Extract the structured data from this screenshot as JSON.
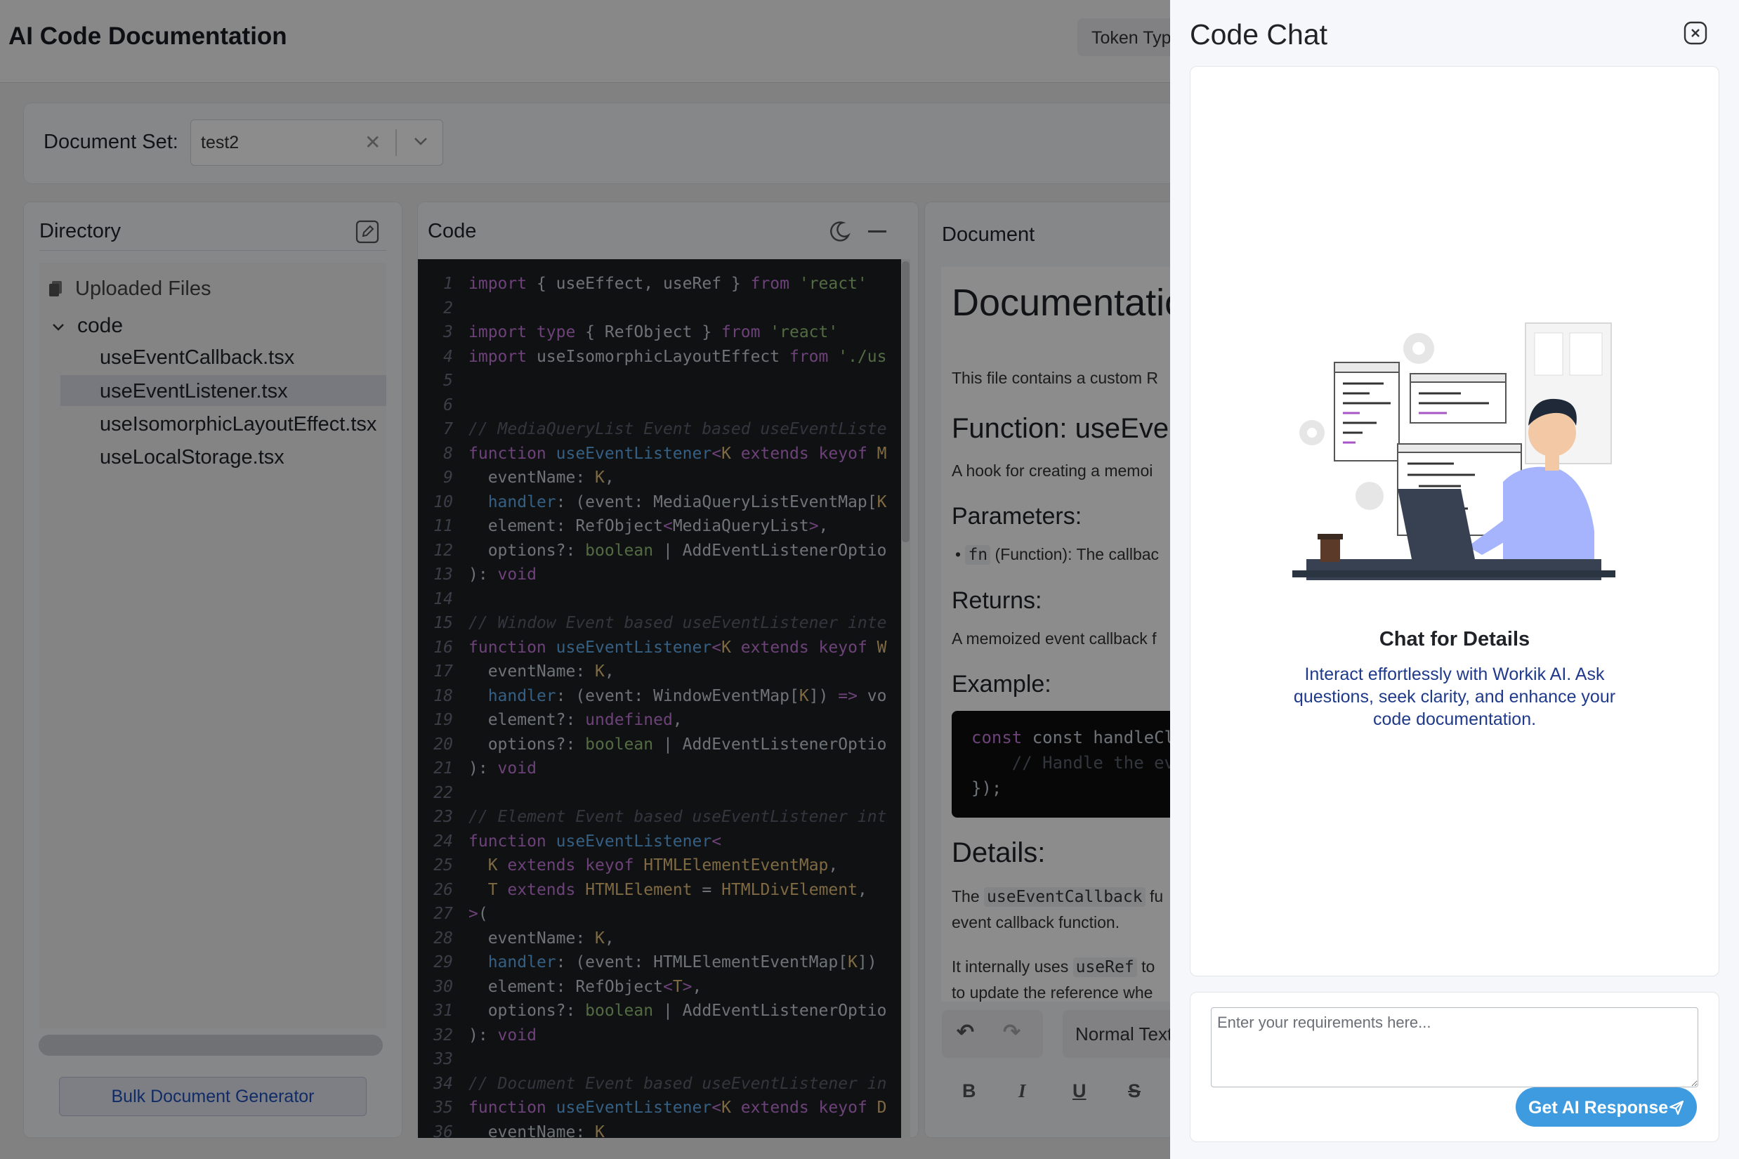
{
  "app": {
    "title": "AI Code Documentation",
    "token_button": "Token Typ"
  },
  "document_set": {
    "label": "Document Set:",
    "value": "test2"
  },
  "directory": {
    "title": "Directory",
    "root_label": "Uploaded Files",
    "folder": "code",
    "files": [
      "useEventCallback.tsx",
      "useEventListener.tsx",
      "useIsomorphicLayoutEffect.tsx",
      "useLocalStorage.tsx"
    ],
    "selected_file": "useEventListener.tsx",
    "bulk_button": "Bulk Document Generator"
  },
  "code": {
    "title": "Code",
    "line_numbers": [
      "1",
      "2",
      "3",
      "4",
      "5",
      "6",
      "7",
      "8",
      "9",
      "10",
      "11",
      "12",
      "13",
      "14",
      "15",
      "16",
      "17",
      "18",
      "19",
      "20",
      "21",
      "22",
      "23",
      "24",
      "25",
      "26",
      "27",
      "28",
      "29",
      "30",
      "31",
      "32",
      "33",
      "34",
      "35",
      "36"
    ]
  },
  "document": {
    "title": "Document",
    "h1": "Documentatio",
    "intro": "This file contains a custom R",
    "function_heading": "Function: useEver",
    "function_desc": "A hook for creating a memoi",
    "params_heading": "Parameters:",
    "param_code": "fn",
    "param_text": " (Function): The callbac",
    "returns_heading": "Returns:",
    "returns_text": "A memoized event callback f",
    "example_heading": "Example:",
    "example_code_1": "const handleClick = u",
    "example_code_2": "    // Handle the eve",
    "example_code_3": "});",
    "details_heading": "Details:",
    "details_pre": "The ",
    "details_code": "useEventCallback",
    "details_post": " fu",
    "details_line2": "event callback function.",
    "details2_pre": "It internally uses ",
    "details2_code": "useRef",
    "details2_post": " to",
    "details2_line2": "to update the reference whe",
    "text_style": "Normal Text"
  },
  "chat": {
    "title": "Code Chat",
    "heading": "Chat for Details",
    "description": "Interact effortlessly with Workik AI. Ask questions, seek clarity, and enhance your code documentation.",
    "input_placeholder": "Enter your requirements here...",
    "submit_button": "Get AI Response"
  }
}
